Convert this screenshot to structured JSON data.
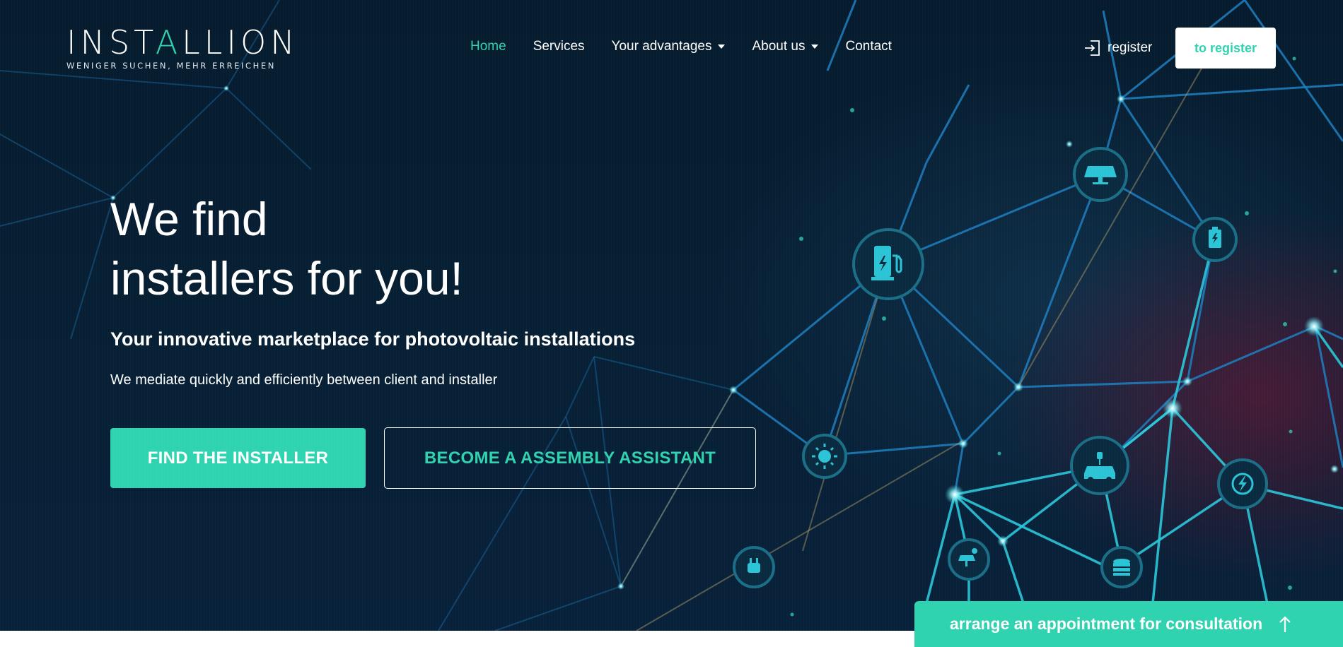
{
  "logo": {
    "word_before": "INST",
    "word_accent": "A",
    "word_after": "LLION",
    "tagline": "WENIGER SUCHEN, MEHR ERREICHEN"
  },
  "nav": {
    "items": [
      {
        "label": "Home",
        "active": true
      },
      {
        "label": "Services"
      },
      {
        "label": "Your advantages",
        "dropdown": true
      },
      {
        "label": "About us",
        "dropdown": true
      },
      {
        "label": "Contact"
      }
    ],
    "login_label": "register",
    "register_button": "to register"
  },
  "hero": {
    "title_line1": "We find",
    "title_line2": "installers for you!",
    "subtitle": "Your innovative marketplace for photovoltaic installations",
    "description": "We mediate quickly and efficiently between client and installer",
    "primary_button": "FIND THE INSTALLER",
    "secondary_button": "BECOME A ASSEMBLY ASSISTANT"
  },
  "consult_button": {
    "label": "arrange an appointment for consultation",
    "icon": "arrow-up-icon"
  },
  "network_icons": [
    "charging-station-icon",
    "solar-panel-icon",
    "battery-icon",
    "sun-icon",
    "electric-car-icon",
    "charge-bolt-icon",
    "plug-icon",
    "solar-plant-icon",
    "storage-icon"
  ],
  "colors": {
    "accent": "#2fd3b0",
    "background": "#061b2e",
    "text": "#ffffff"
  }
}
